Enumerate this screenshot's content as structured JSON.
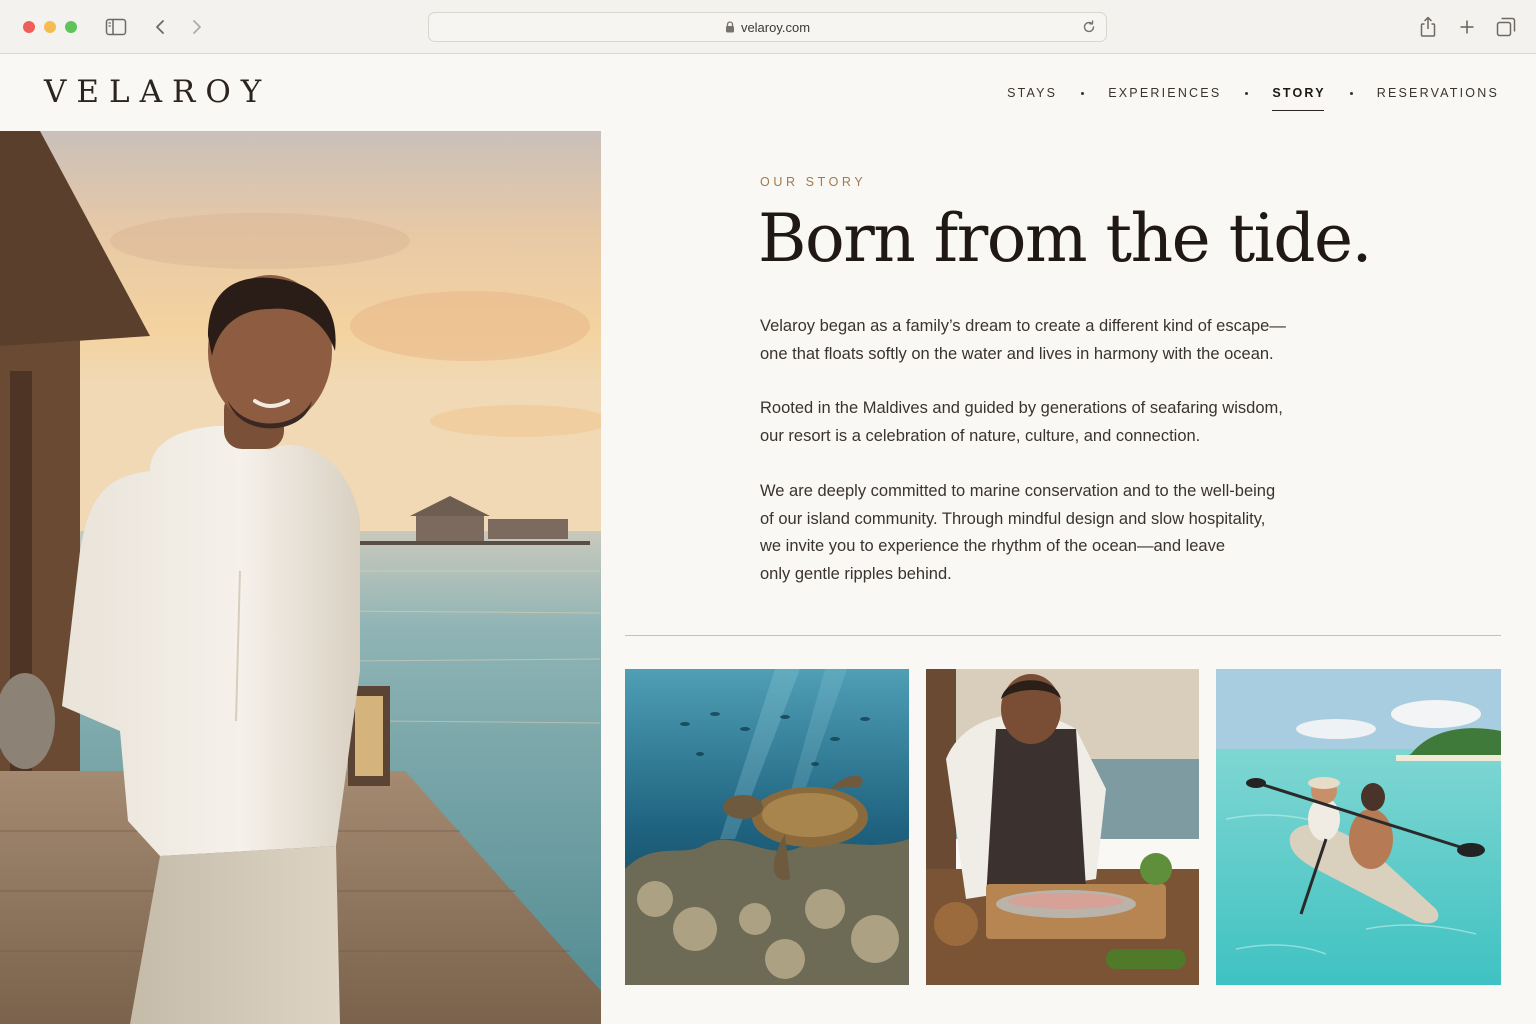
{
  "browser": {
    "url": "velaroy.com",
    "icons": [
      "sidebar-icon",
      "back-icon",
      "forward-icon",
      "lock-icon",
      "reload-icon",
      "share-icon",
      "new-tab-icon",
      "tabs-overview-icon"
    ]
  },
  "site": {
    "logo": "VELAROY",
    "nav": [
      {
        "label": "STAYS",
        "active": false
      },
      {
        "label": "EXPERIENCES",
        "active": false
      },
      {
        "label": "STORY",
        "active": true
      },
      {
        "label": "RESERVATIONS",
        "active": false
      }
    ]
  },
  "story": {
    "eyebrow": "OUR STORY",
    "headline": "Born from the tide.",
    "paragraphs": [
      [
        "Velaroy began as a family’s dream to create a different kind of escape—",
        "one that floats softly on the water and lives in harmony with the ocean."
      ],
      [
        "Rooted in the Maldives and guided by generations of seafaring wisdom,",
        "our resort is a celebration of nature, culture, and connection."
      ],
      [
        "We are deeply committed to marine conservation and to the well-being",
        "of our island community. Through mindful design and slow hospitality,",
        "we invite you to experience the rhythm of the ocean—and leave",
        "only gentle ripples behind."
      ]
    ]
  },
  "colors": {
    "page_background": "#faf8f4",
    "accent": "#a07a4d",
    "text_dark": "#1f1815",
    "divider": "#cfbfa9"
  }
}
